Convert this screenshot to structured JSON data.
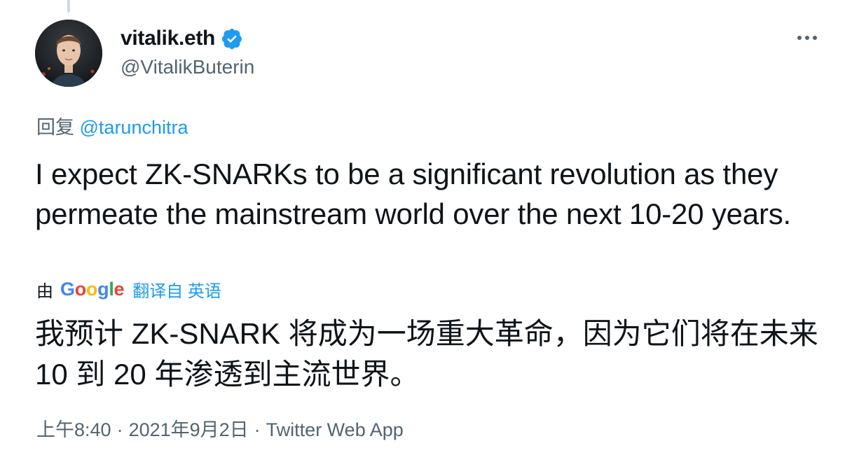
{
  "author": {
    "display_name": "vitalik.eth",
    "handle": "@VitalikButerin",
    "avatar_icon": "user-avatar-photo",
    "verified_icon": "verified-badge-icon",
    "verified_color": "#1d9bf0"
  },
  "menu": {
    "more_icon": "more-horizontal-icon"
  },
  "reply": {
    "prefix": "回复",
    "mention": "@tarunchitra"
  },
  "tweet": {
    "text": "I expect ZK-SNARKs to be a significant revolution as they permeate the mainstream world over the next 10-20 years."
  },
  "translation": {
    "by_label": "由",
    "provider": "Google",
    "link_label": "翻译自 英语",
    "text": "我预计 ZK-SNARK 将成为一场重大革命，因为它们将在未来 10 到 20 年渗透到主流世界。"
  },
  "meta": {
    "time": "上午8:40",
    "separator": "·",
    "date": "2021年9月2日",
    "source": "Twitter Web App"
  },
  "colors": {
    "text_primary": "#0f1419",
    "text_secondary": "#536471",
    "link": "#1d9bf0"
  }
}
